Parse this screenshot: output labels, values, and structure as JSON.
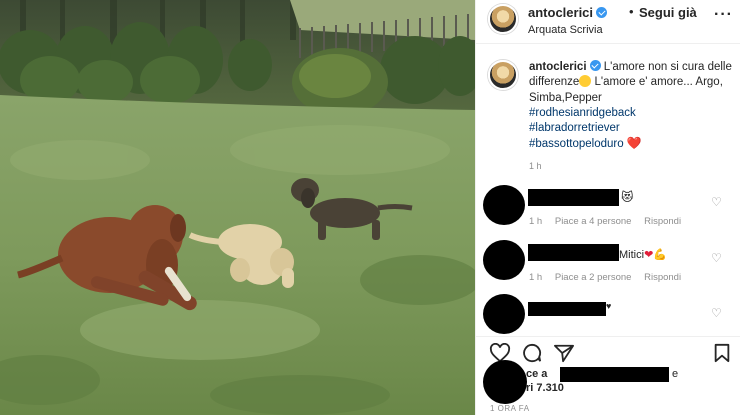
{
  "post": {
    "username": "antoclerici",
    "separator": "•",
    "follow_label": "Segui già",
    "location": "Arquata Scrivia",
    "more_icon": "more-horizontal-icon"
  },
  "caption": {
    "username": "antoclerici",
    "text": "L'amore non si cura delle differenze",
    "text2": "L'amore e' amore... Argo, Simba,Pepper",
    "hashtags": [
      "#rodhesianridgeback",
      "#labradorretriever",
      "#bassottopeloduro"
    ],
    "time": "1 h"
  },
  "comments": [
    {
      "text_suffix": "",
      "time": "1 h",
      "likes_label": "Piace a 4 persone",
      "reply_label": "Rispondi",
      "emoji": "smiling-face-with-heart-eyes"
    },
    {
      "text_suffix": "Mitici",
      "time": "1 h",
      "likes_label": "Piace a 2 persone",
      "reply_label": "Rispondi",
      "emoji": "heart-and-flexed-biceps"
    },
    {
      "text_suffix": "",
      "time": "",
      "likes_label": "",
      "reply_label": "",
      "emoji": "heart"
    }
  ],
  "actions": {
    "like_icon": "heart-outline-icon",
    "comment_icon": "comment-icon",
    "share_icon": "paper-plane-icon",
    "save_icon": "bookmark-icon"
  },
  "likes": {
    "line1_prefix": "ce a",
    "line1_suffix": "e",
    "line2": "ri 7.310"
  },
  "date_label": "1 ORA FA",
  "colors": {
    "link": "#00376b",
    "verified": "#3897f0",
    "secondary_text": "#8e8e8e",
    "heart": "#e21f3a"
  }
}
